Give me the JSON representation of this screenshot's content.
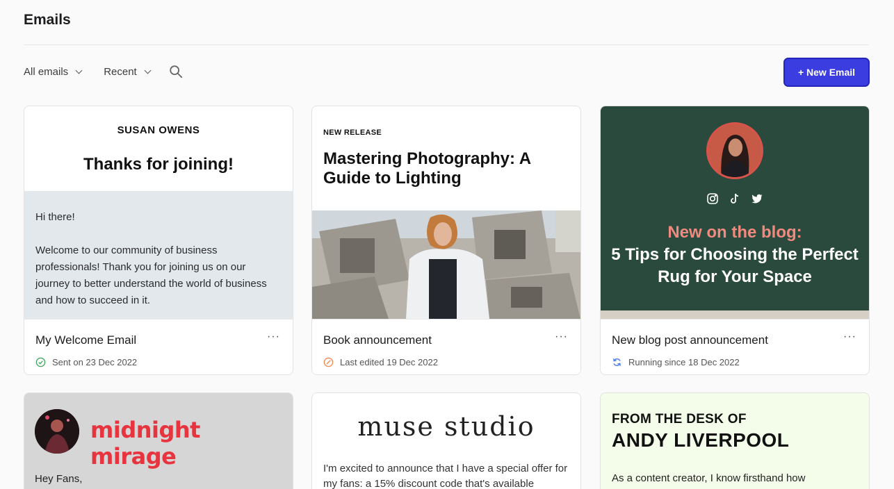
{
  "page": {
    "title": "Emails"
  },
  "filters": {
    "all_emails": "All emails",
    "recent": "Recent"
  },
  "toolbar": {
    "new_email": "+ New Email"
  },
  "cards": [
    {
      "brand": "SUSAN OWENS",
      "heading": "Thanks for joining!",
      "greeting": "Hi there!",
      "body": "Welcome to our community of business professionals! Thank you for joining us on our journey to better understand the world of business and how to succeed in it.",
      "name": "My Welcome Email",
      "status": "Sent on 23 Dec 2022",
      "status_color": "#3aa55a"
    },
    {
      "kicker": "NEW RELEASE",
      "heading": "Mastering Photography: A Guide to Lighting",
      "name": "Book announcement",
      "status": "Last edited 19 Dec 2022",
      "status_color": "#f0864a"
    },
    {
      "kicker": "New on the blog:",
      "heading": "5 Tips for Choosing the Perfect Rug for Your Space",
      "name": "New blog post announcement",
      "status": "Running since 18 Dec 2022",
      "status_color": "#4a7ee8"
    },
    {
      "brand": "midnight mirage",
      "body": "Hey Fans,"
    },
    {
      "brand": "muse studio",
      "body": "I'm excited to announce that I have a special offer for my fans: a 15% discount code that's available"
    },
    {
      "kicker": "FROM THE DESK OF",
      "brand": "ANDY LIVERPOOL",
      "body": "As a content creator, I know firsthand how"
    }
  ],
  "colors": {
    "accent": "#3b3de0",
    "blog_bg": "#2b4a3e",
    "blog_kicker": "#f08a7e",
    "welcome_body_bg": "#e3e8ed"
  }
}
